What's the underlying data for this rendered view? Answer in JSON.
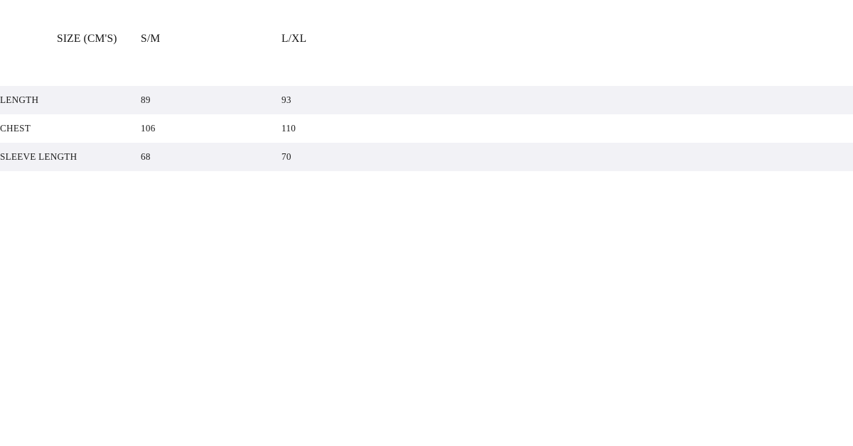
{
  "chart_data": {
    "type": "table",
    "title": "",
    "unit": "cm",
    "columns": [
      "SIZE (CM'S)",
      "S/M",
      "L/XL"
    ],
    "categories": [
      "LENGTH",
      "CHEST",
      "SLEEVE LENGTH"
    ],
    "series": [
      {
        "name": "S/M",
        "values": [
          89,
          106,
          68
        ]
      },
      {
        "name": "L/XL",
        "values": [
          93,
          110,
          70
        ]
      }
    ],
    "rows": [
      {
        "label": "LENGTH",
        "sm": "89",
        "lxl": "93"
      },
      {
        "label": "CHEST",
        "sm": "106",
        "lxl": "110"
      },
      {
        "label": "SLEEVE LENGTH",
        "sm": "68",
        "lxl": "70"
      }
    ]
  },
  "table": {
    "header": {
      "measurement": "SIZE (CM'S)",
      "size_sm": "S/M",
      "size_lxl": "L/XL"
    },
    "rows": [
      {
        "label": "LENGTH",
        "sm": "89",
        "lxl": "93"
      },
      {
        "label": "CHEST",
        "sm": "106",
        "lxl": "110"
      },
      {
        "label": "SLEEVE LENGTH",
        "sm": "68",
        "lxl": "70"
      }
    ]
  },
  "colors": {
    "background": "#ffffff",
    "row_stripe": "#f2f2f6",
    "text": "#1a1a1a",
    "header_text": "#111111"
  }
}
